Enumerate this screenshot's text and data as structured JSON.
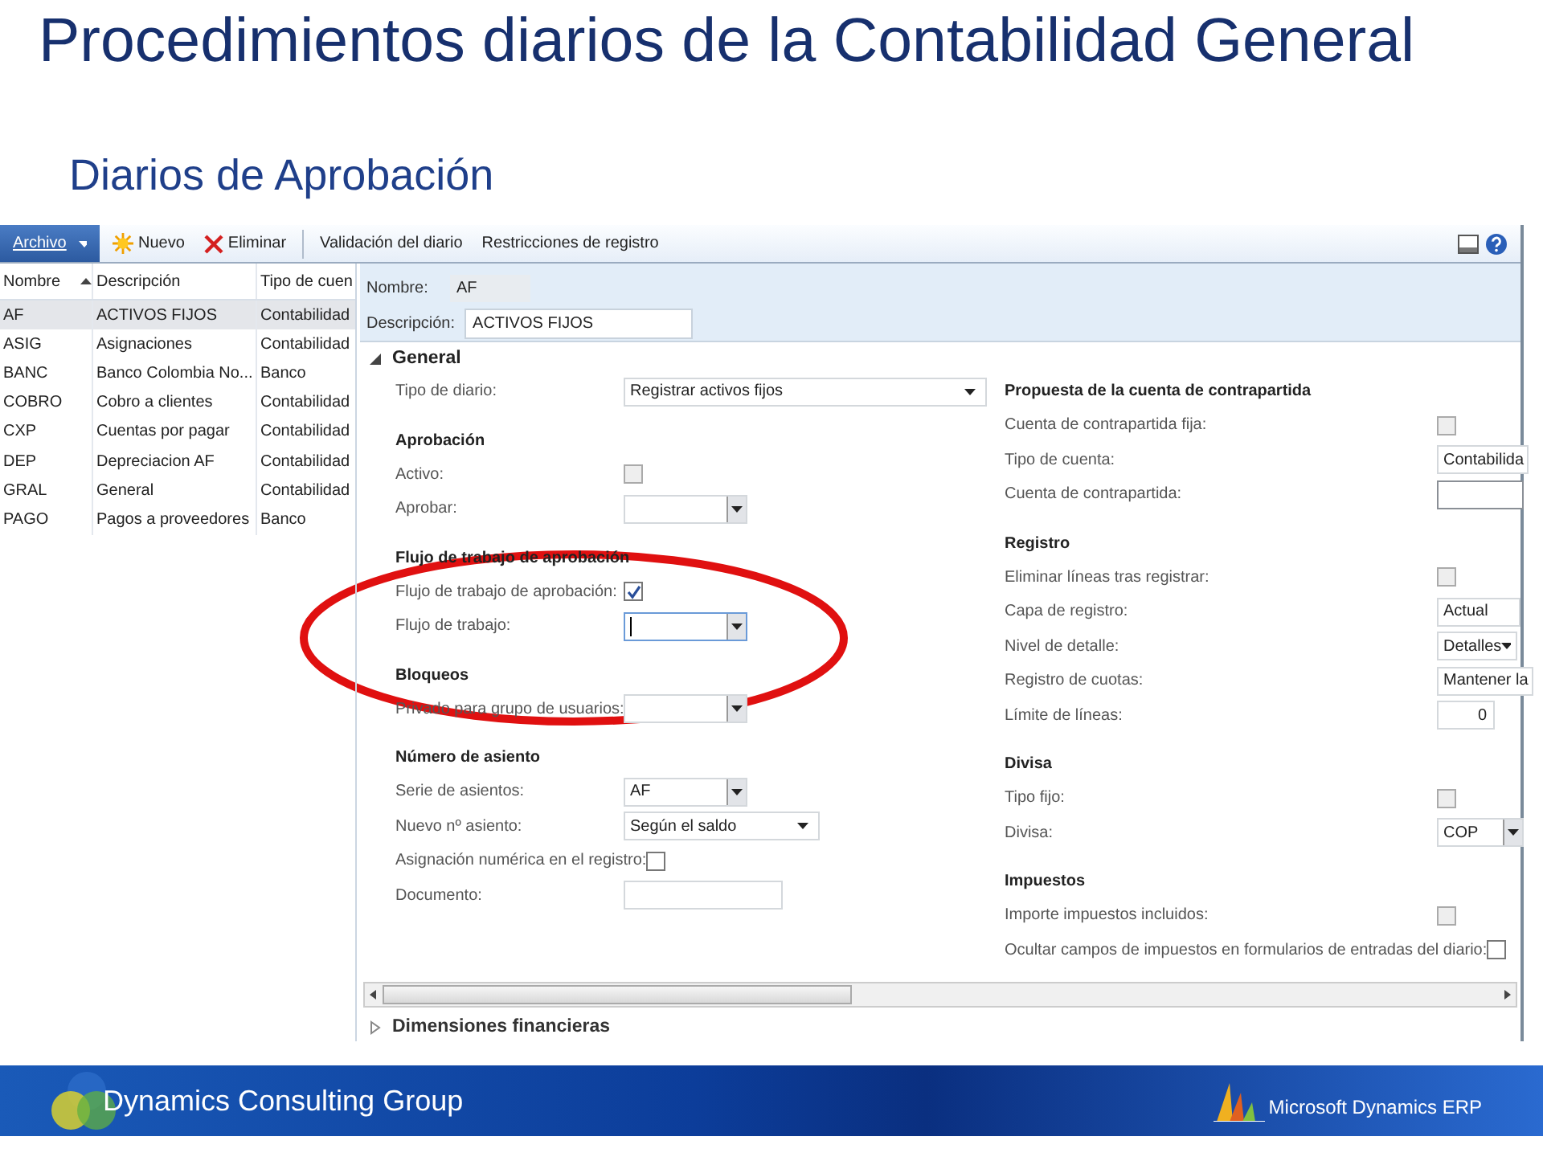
{
  "slide": {
    "title": "Procedimientos diarios de la Contabilidad General",
    "subtitle": "Diarios de Aprobación"
  },
  "toolbar": {
    "file_menu": "Archivo",
    "buttons": [
      {
        "label": "Nuevo",
        "kind": "new"
      },
      {
        "label": "Eliminar",
        "kind": "delete"
      },
      {
        "label": "Validación del diario",
        "kind": "plain"
      },
      {
        "label": "Restricciones de registro",
        "kind": "plain"
      }
    ]
  },
  "list": {
    "columns": [
      "Nombre",
      "Descripción",
      "Tipo de cuen"
    ],
    "rows": [
      {
        "cells": [
          "AF",
          "ACTIVOS FIJOS",
          "Contabilidad"
        ],
        "selected": true
      },
      {
        "cells": [
          "ASIG",
          "Asignaciones",
          "Contabilidad"
        ],
        "selected": false
      },
      {
        "cells": [
          "BANC",
          "Banco Colombia No...",
          "Banco"
        ],
        "selected": false
      },
      {
        "cells": [
          "COBRO",
          "Cobro a clientes",
          "Contabilidad"
        ],
        "selected": false
      },
      {
        "cells": [
          "CXP",
          "Cuentas por pagar",
          "Contabilidad"
        ],
        "selected": false
      },
      {
        "cells": [
          "DEP",
          "Depreciacion AF",
          "Contabilidad"
        ],
        "selected": false
      },
      {
        "cells": [
          "GRAL",
          "General",
          "Contabilidad"
        ],
        "selected": false
      },
      {
        "cells": [
          "PAGO",
          "Pagos a proveedores",
          "Banco"
        ],
        "selected": false
      }
    ]
  },
  "header": {
    "fields": [
      {
        "label": "Nombre:",
        "value": "AF",
        "kind": "readonly"
      },
      {
        "label": "Descripción:",
        "value": "ACTIVOS FIJOS",
        "kind": "text"
      }
    ]
  },
  "general": {
    "title": "General",
    "expanded": true,
    "left": [
      {
        "fields": [
          {
            "label": "Tipo de diario:",
            "kind": "dropdown",
            "value": "Registrar activos fijos"
          }
        ]
      },
      {
        "heading": "Aprobación",
        "fields": [
          {
            "label": "Activo:",
            "kind": "checkbox",
            "checked": false,
            "disabled": true
          },
          {
            "label": "Aprobar:",
            "kind": "lookup"
          }
        ]
      },
      {
        "heading": "Flujo de trabajo de aprobación",
        "fields": [
          {
            "label": "Flujo de trabajo de aprobación:",
            "kind": "checkbox",
            "checked": true,
            "disabled": false
          },
          {
            "label": "Flujo de trabajo:",
            "kind": "lookup",
            "focused": true
          }
        ]
      },
      {
        "heading": "Bloqueos",
        "fields": [
          {
            "label": "Privado para grupo de usuarios:",
            "kind": "lookup"
          }
        ]
      },
      {
        "heading": "Número de asiento",
        "fields": [
          {
            "label": "Serie de asientos:",
            "kind": "lookup",
            "value": "AF"
          },
          {
            "label": "Nuevo nº asiento:",
            "kind": "dropdown",
            "value": "Según el saldo"
          },
          {
            "label": "Asignación numérica en el registro:",
            "kind": "checkbox",
            "checked": false,
            "disabled": false
          },
          {
            "label": "Documento:",
            "kind": "text"
          }
        ]
      }
    ],
    "right": [
      {
        "heading": "Propuesta de la cuenta de contrapartida",
        "fields": [
          {
            "label": "Cuenta de contrapartida fija:",
            "kind": "checkbox",
            "checked": false,
            "disabled": true
          },
          {
            "label": "Tipo de cuenta:",
            "kind": "text",
            "value": "Contabilida"
          },
          {
            "label": "Cuenta de contrapartida:",
            "kind": "input"
          }
        ]
      },
      {
        "heading": "Registro",
        "fields": [
          {
            "label": "Eliminar líneas tras registrar:",
            "kind": "checkbox",
            "checked": false,
            "disabled": true
          },
          {
            "label": "Capa de registro:",
            "kind": "text",
            "value": "Actual"
          },
          {
            "label": "Nivel de detalle:",
            "kind": "dropdown",
            "value": "Detalles"
          },
          {
            "label": "Registro de cuotas:",
            "kind": "text",
            "value": "Mantener la"
          },
          {
            "label": "Límite de líneas:",
            "kind": "number",
            "value": "0"
          }
        ]
      },
      {
        "heading": "Divisa",
        "fields": [
          {
            "label": "Tipo fijo:",
            "kind": "checkbox",
            "checked": false,
            "disabled": true
          },
          {
            "label": "Divisa:",
            "kind": "lookup",
            "value": "COP"
          }
        ]
      },
      {
        "heading": "Impuestos",
        "fields": [
          {
            "label": "Importe impuestos incluidos:",
            "kind": "checkbox",
            "checked": false,
            "disabled": true
          },
          {
            "label": "Ocultar campos de impuestos en formularios de entradas del diario:",
            "kind": "checkbox",
            "checked": false,
            "disabled": false
          }
        ]
      }
    ]
  },
  "collapsed_section": {
    "title": "Dimensiones financieras",
    "expanded": false
  },
  "footer": {
    "company": "Dynamics Consulting Group",
    "product": "Microsoft Dynamics ERP"
  }
}
